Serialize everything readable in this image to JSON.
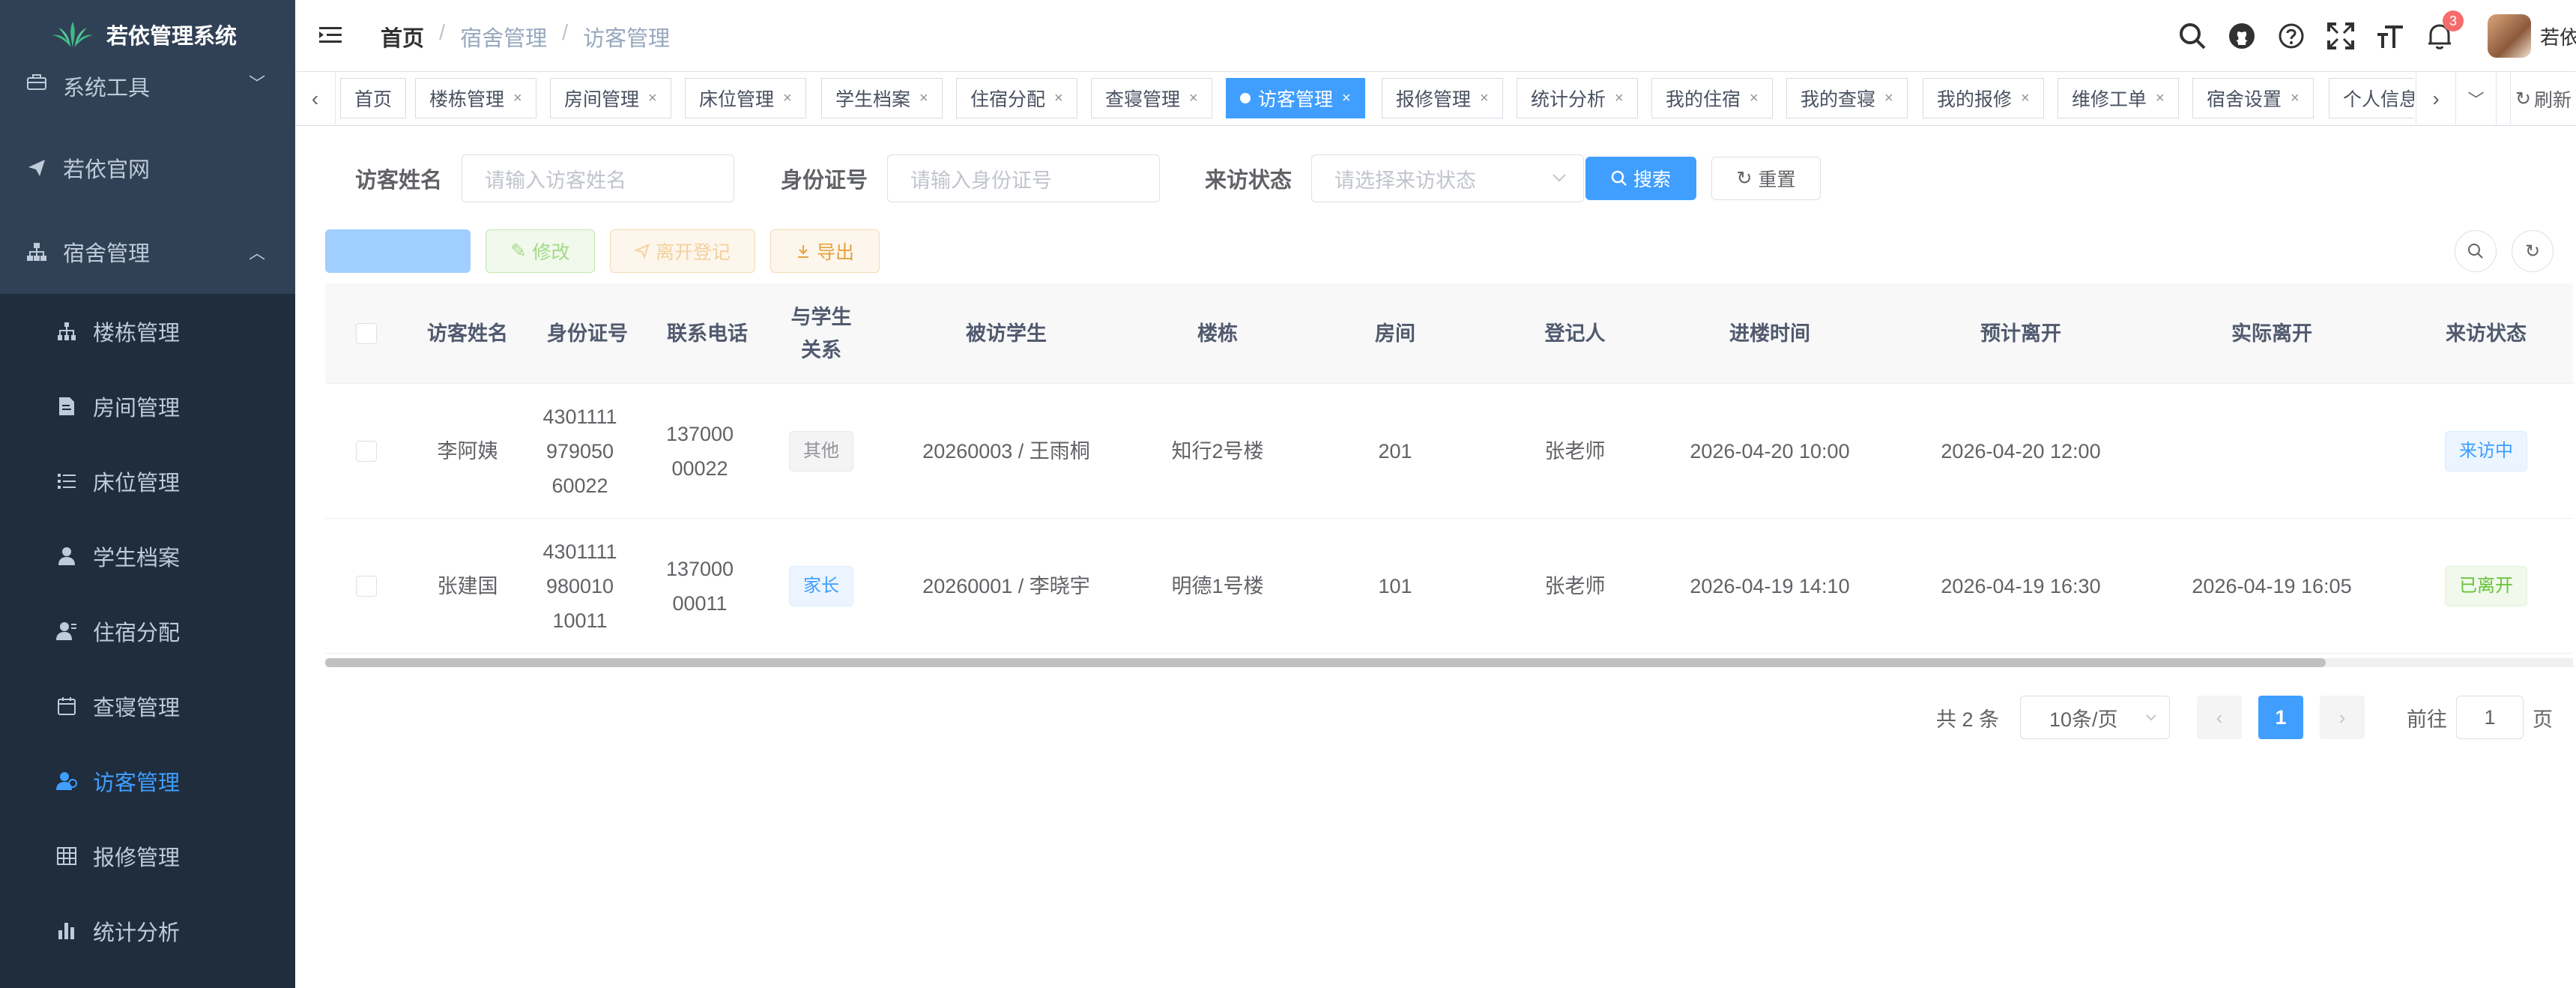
{
  "app": {
    "title": "若依管理系统"
  },
  "sidebar": {
    "top_items": [
      {
        "label": "系统工具",
        "icon": "toolbox-icon",
        "arrow": "﹀"
      },
      {
        "label": "若依官网",
        "icon": "send-icon"
      },
      {
        "label": "宿舍管理",
        "icon": "tree-icon",
        "arrow": "︿"
      }
    ],
    "sub_items": [
      {
        "label": "楼栋管理",
        "icon": "building-icon"
      },
      {
        "label": "房间管理",
        "icon": "document-icon"
      },
      {
        "label": "床位管理",
        "icon": "list-icon"
      },
      {
        "label": "学生档案",
        "icon": "user-icon"
      },
      {
        "label": "住宿分配",
        "icon": "user-assign-icon"
      },
      {
        "label": "查寝管理",
        "icon": "calendar-icon"
      },
      {
        "label": "访客管理",
        "icon": "visitor-icon",
        "active": true
      },
      {
        "label": "报修管理",
        "icon": "table-icon"
      },
      {
        "label": "统计分析",
        "icon": "bar-chart-icon"
      }
    ],
    "colors": {
      "bg": "#304156",
      "sub_bg": "#1f2d3d",
      "active": "#409eff"
    }
  },
  "navbar": {
    "breadcrumb": [
      "首页",
      "宿舍管理",
      "访客管理"
    ],
    "notification_count": "3",
    "username": "若依"
  },
  "tags": {
    "items": [
      "首页",
      "楼栋管理",
      "房间管理",
      "床位管理",
      "学生档案",
      "住宿分配",
      "查寝管理",
      "访客管理",
      "报修管理",
      "统计分析",
      "我的住宿",
      "我的查寝",
      "我的报修",
      "维修工单",
      "宿舍设置",
      "个人信息"
    ],
    "active": "访客管理",
    "refresh_label": "刷新",
    "close_glyph": "×"
  },
  "search": {
    "visitor_name_label": "访客姓名",
    "visitor_name_placeholder": "请输入访客姓名",
    "id_card_label": "身份证号",
    "id_card_placeholder": "请输入身份证号",
    "status_label": "来访状态",
    "status_placeholder": "请选择来访状态",
    "search_button": "搜索",
    "reset_button": "重置"
  },
  "toolbar": {
    "add_label": "",
    "edit_label": "修改",
    "leave_label": "离开登记",
    "export_label": "导出"
  },
  "table": {
    "columns": [
      "访客姓名",
      "身份证号",
      "联系电话",
      "与学生关系",
      "被访学生",
      "楼栋",
      "房间",
      "登记人",
      "进楼时间",
      "预计离开",
      "实际离开",
      "来访状态"
    ],
    "rows": [
      {
        "name": "李阿姨",
        "id_card": "430111197905060022",
        "phone": "13700000022",
        "relation": "其他",
        "relation_type": "info",
        "student": "20260003 / 王雨桐",
        "building": "知行2号楼",
        "room": "201",
        "registrar": "张老师",
        "enter_time": "2026-04-20 10:00",
        "expected_leave": "2026-04-20 12:00",
        "actual_leave": "",
        "status": "来访中",
        "status_type": "primary"
      },
      {
        "name": "张建国",
        "id_card": "430111198001010011",
        "phone": "13700000011",
        "relation": "家长",
        "relation_type": "primary",
        "student": "20260001 / 李晓宇",
        "building": "明德1号楼",
        "room": "101",
        "registrar": "张老师",
        "enter_time": "2026-04-19 14:10",
        "expected_leave": "2026-04-19 16:30",
        "actual_leave": "2026-04-19 16:05",
        "status": "已离开",
        "status_type": "success"
      }
    ]
  },
  "pagination": {
    "total_text": "共 2 条",
    "page_size": "10条/页",
    "current_page": "1",
    "goto_prefix": "前往",
    "goto_value": "1",
    "goto_suffix": "页"
  }
}
